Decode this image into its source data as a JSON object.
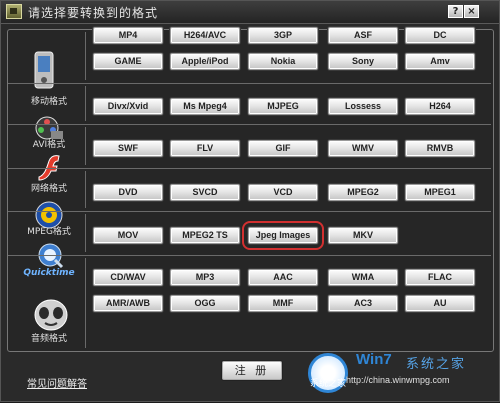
{
  "window": {
    "title": "请选择要转换到的格式",
    "help_label": "?",
    "close_label": "×"
  },
  "categories": [
    {
      "label": "移动格式",
      "icon": "mobile-phone-icon",
      "rows": [
        [
          "MP4",
          "H264/AVC",
          "3GP",
          "ASF",
          "DC"
        ],
        [
          "GAME",
          "Apple/iPod",
          "Nokia",
          "Sony",
          "Amv"
        ]
      ]
    },
    {
      "label": "AVI格式",
      "icon": "film-reel-icon",
      "rows": [
        [
          "Divx/Xvid",
          "Ms Mpeg4",
          "MJPEG",
          "Lossess",
          "H264"
        ]
      ]
    },
    {
      "label": "网络格式",
      "icon": "flash-icon",
      "rows": [
        [
          "SWF",
          "FLV",
          "GIF",
          "WMV",
          "RMVB"
        ]
      ]
    },
    {
      "label": "MPEG格式",
      "icon": "mpeg-disc-icon",
      "rows": [
        [
          "DVD",
          "SVCD",
          "VCD",
          "MPEG2",
          "MPEG1"
        ]
      ]
    },
    {
      "label": "Quicktime",
      "icon": "quicktime-icon",
      "rows": [
        [
          "MOV",
          "MPEG2 TS",
          "Jpeg Images",
          "MKV"
        ]
      ],
      "selected": "Jpeg Images"
    },
    {
      "label": "音频格式",
      "icon": "audio-face-icon",
      "rows": [
        [
          "CD/WAV",
          "MP3",
          "AAC",
          "WMA",
          "FLAC"
        ],
        [
          "AMR/AWB",
          "OGG",
          "MMF",
          "AC3",
          "AU"
        ]
      ]
    }
  ],
  "register_label": "注 册",
  "faq_label": "常见问题解答",
  "watermark": {
    "brand": "Win7",
    "cn": "系统之家",
    "url": "http://china.winwmpg.com",
    "sub": "系统之家"
  },
  "colors": {
    "highlight": "#d23030",
    "panel": "#262626",
    "titlebar": "#2e2e2e"
  }
}
